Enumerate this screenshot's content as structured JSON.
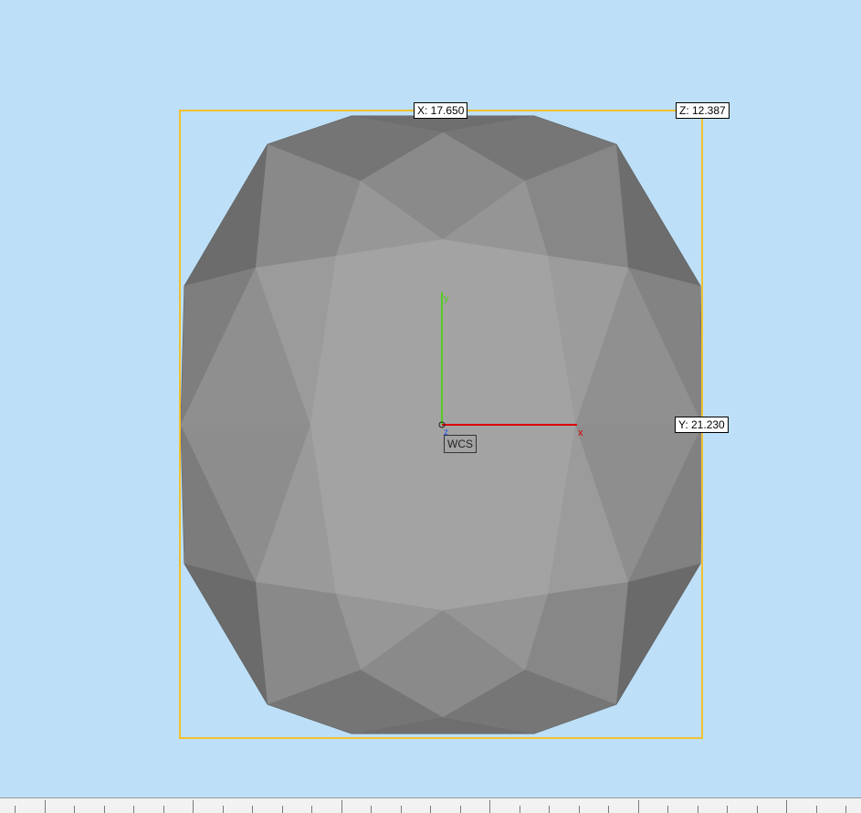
{
  "dimensions": {
    "x_label": "X: 17.650",
    "y_label": "Y: 21.230",
    "z_label": "Z: 12.387"
  },
  "coordinate_system": {
    "label": "WCS",
    "x_axis_label": "x",
    "y_axis_label": "y",
    "z_axis_label": "z"
  },
  "colors": {
    "background": "#bde0f8",
    "bounding_box": "#f0c030",
    "x_axis": "#dd0000",
    "y_axis": "#55cc22",
    "z_axis": "#2255ee"
  }
}
